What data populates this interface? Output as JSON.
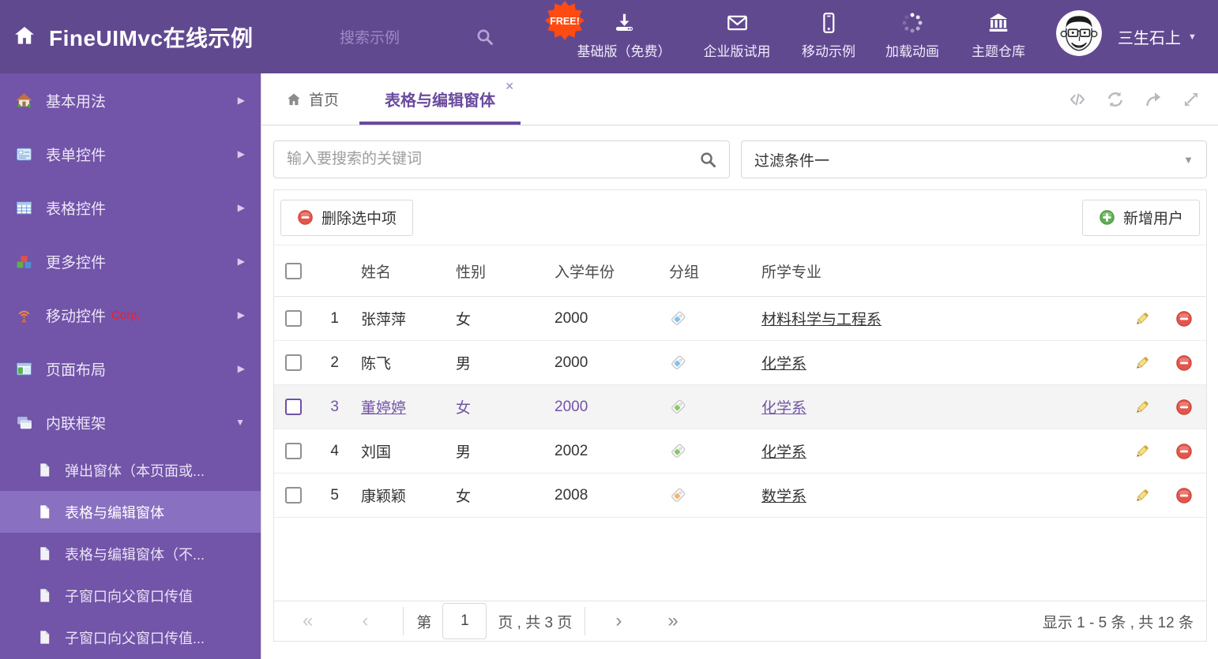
{
  "colors": {
    "header_bg": "#614990",
    "sidebar_bg": "#7254a9",
    "accent_purple": "#6b4a9e",
    "free_badge_bg": "#ff4a12",
    "corp_red": "#ff1a1a",
    "selected_row_bg": "#f4f4f4",
    "selected_row_text": "#7253a7",
    "delete_red": "#e4564c",
    "add_green": "#5fae55"
  },
  "icons": {
    "first": "«",
    "prev": "‹",
    "next": "›",
    "last": "»",
    "caret_down": "▼",
    "expand_right": "▶",
    "close": "✕"
  },
  "header": {
    "title": "FineUIMvc在线示例",
    "search_placeholder": "搜索示例",
    "free_badge": "FREE!",
    "nav": [
      {
        "label": "基础版（免费）"
      },
      {
        "label": "企业版试用"
      },
      {
        "label": "移动示例"
      },
      {
        "label": "加载动画"
      },
      {
        "label": "主题仓库"
      }
    ],
    "username": "三生石上"
  },
  "sidebar": {
    "items": [
      {
        "label": "基本用法"
      },
      {
        "label": "表单控件"
      },
      {
        "label": "表格控件"
      },
      {
        "label": "更多控件"
      },
      {
        "label": "移动控件",
        "badge": "Corp."
      },
      {
        "label": "页面布局"
      },
      {
        "label": "内联框架"
      }
    ],
    "subitems": [
      {
        "label": "弹出窗体（本页面或..."
      },
      {
        "label": "表格与编辑窗体"
      },
      {
        "label": "表格与编辑窗体（不..."
      },
      {
        "label": "子窗口向父窗口传值"
      },
      {
        "label": "子窗口向父窗口传值..."
      }
    ]
  },
  "tabs": {
    "home": "首页",
    "active": "表格与编辑窗体"
  },
  "filters": {
    "search_placeholder": "输入要搜索的关键词",
    "dropdown_value": "过滤条件一"
  },
  "toolbar": {
    "delete": "删除选中项",
    "add": "新增用户"
  },
  "table": {
    "columns": [
      "姓名",
      "性别",
      "入学年份",
      "分组",
      "所学专业"
    ],
    "rows": [
      {
        "num": "1",
        "name": "张萍萍",
        "gender": "女",
        "year": "2000",
        "tag_color": "#7fc3ef",
        "major": "材料科学与工程系"
      },
      {
        "num": "2",
        "name": "陈飞",
        "gender": "男",
        "year": "2000",
        "tag_color": "#7fc3ef",
        "major": "化学系"
      },
      {
        "num": "3",
        "name": "董婷婷",
        "gender": "女",
        "year": "2000",
        "tag_color": "#8bc763",
        "major": "化学系"
      },
      {
        "num": "4",
        "name": "刘国",
        "gender": "男",
        "year": "2002",
        "tag_color": "#8bc763",
        "major": "化学系"
      },
      {
        "num": "5",
        "name": "康颖颖",
        "gender": "女",
        "year": "2008",
        "tag_color": "#f6b26f",
        "major": "数学系"
      }
    ]
  },
  "pagination": {
    "prefix": "第",
    "page": "1",
    "suffix": "页 , 共 3 页",
    "summary": "显示 1 - 5 条 , 共 12 条"
  }
}
